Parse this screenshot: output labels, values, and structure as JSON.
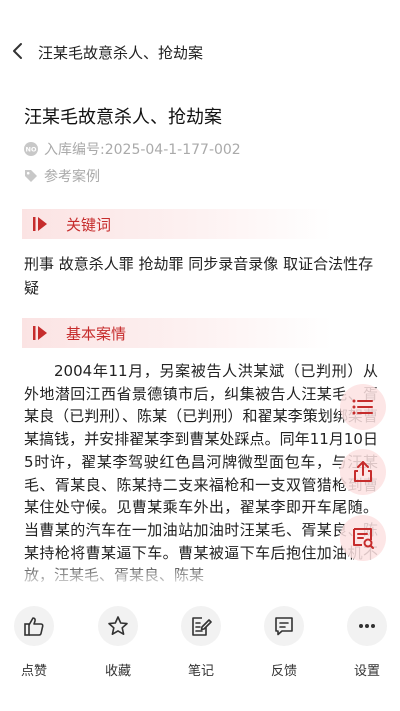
{
  "header": {
    "title": "汪某毛故意杀人、抢劫案"
  },
  "article": {
    "title": "汪某毛故意杀人、抢劫案",
    "case_number": "入库编号:2025-04-1-177-002",
    "category": "参考案例"
  },
  "sections": {
    "keywords_title": "关键词",
    "keywords_text": "刑事 故意杀人罪 抢劫罪 同步录音录像 取证合法性存疑",
    "facts_title": "基本案情",
    "facts_text": "2004年11月，另案被告人洪某斌（已判刑）从外地潜回江西省景德镇市后，纠集被告人汪某毛、胥某良（已判刑）、陈某（已判刑）和翟某李策划绑架曹某搞钱，并安排翟某李到曹某处踩点。同年11月10日5时许，翟某李驾驶红色昌河牌微型面包车，与汪某毛、胥某良、陈某持二支来福枪和一支双管猎枪到曹某住处守候。见曹某乘车外出，翟某李即开车尾随。当曹某的汽车在一加油站加油时汪某毛、胥某良、陈某持枪将曹某逼下车。曹某被逼下车后抱住加油机不放，汪某毛、胥某良、陈某"
  },
  "bottom_bar": [
    {
      "label": "点赞",
      "icon": "thumbs-up-icon"
    },
    {
      "label": "收藏",
      "icon": "star-icon"
    },
    {
      "label": "笔记",
      "icon": "note-edit-icon"
    },
    {
      "label": "反馈",
      "icon": "feedback-icon"
    },
    {
      "label": "设置",
      "icon": "more-icon"
    }
  ],
  "floating_buttons": [
    "list-menu-icon",
    "share-icon",
    "comment-icon"
  ],
  "colors": {
    "accent": "#c62c2c",
    "meta_gray": "#aaaaaa",
    "float_bg": "#fde2e2"
  }
}
